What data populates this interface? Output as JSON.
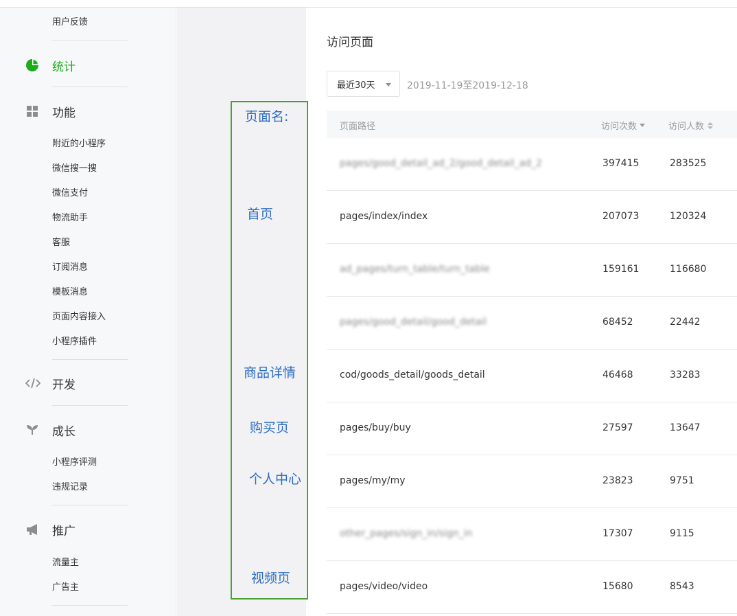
{
  "sidebar": {
    "top_item": "用户反馈",
    "groups": {
      "stats": {
        "label": "统计",
        "icon": "pie-chart-icon",
        "color": "#1aad19"
      },
      "features": {
        "label": "功能",
        "icon": "grid-icon",
        "items": [
          "附近的小程序",
          "微信搜一搜",
          "微信支付",
          "物流助手",
          "客服",
          "订阅消息",
          "模板消息",
          "页面内容接入",
          "小程序插件"
        ]
      },
      "dev": {
        "label": "开发",
        "icon": "code-icon"
      },
      "growth": {
        "label": "成长",
        "icon": "sprout-icon",
        "items": [
          "小程序评测",
          "违规记录"
        ]
      },
      "promo": {
        "label": "推广",
        "icon": "megaphone-icon",
        "items": [
          "流量主",
          "广告主"
        ]
      }
    }
  },
  "annotation": {
    "border_color": "#4b9f35",
    "labels": [
      "页面名:",
      "首页",
      "商品详情",
      "购买页",
      "个人中心",
      "视频页"
    ]
  },
  "main": {
    "title": "访问页面",
    "range": "最近30天",
    "date_span": "2019-11-19至2019-12-18",
    "columns": [
      "页面路径",
      "访问次数",
      "访问人数"
    ],
    "rows": [
      {
        "path": "pages/good_detail_ad_2/good_detail_ad_2",
        "visits": "397415",
        "users": "283525",
        "blurred": true
      },
      {
        "path": "pages/index/index",
        "visits": "207073",
        "users": "120324",
        "blurred": false
      },
      {
        "path": "ad_pages/turn_table/turn_table",
        "visits": "159161",
        "users": "116680",
        "blurred": true
      },
      {
        "path": "pages/good_detail/good_detail",
        "visits": "68452",
        "users": "22442",
        "blurred": true
      },
      {
        "path": "cod/goods_detail/goods_detail",
        "visits": "46468",
        "users": "33283",
        "blurred": false
      },
      {
        "path": "pages/buy/buy",
        "visits": "27597",
        "users": "13647",
        "blurred": false
      },
      {
        "path": "pages/my/my",
        "visits": "23823",
        "users": "9751",
        "blurred": false
      },
      {
        "path": "other_pages/sign_in/sign_in",
        "visits": "17307",
        "users": "9115",
        "blurred": true
      },
      {
        "path": "pages/video/video",
        "visits": "15680",
        "users": "8543",
        "blurred": false
      }
    ]
  }
}
